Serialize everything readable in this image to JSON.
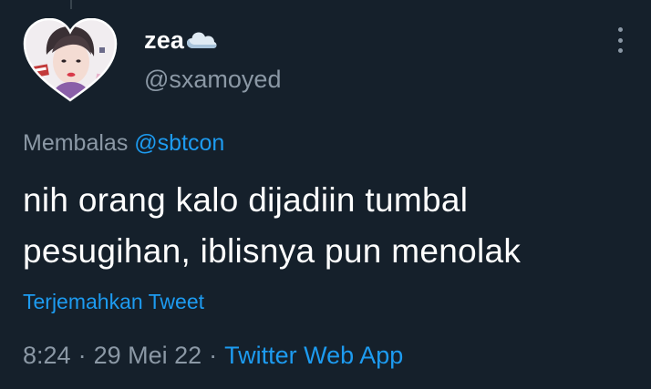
{
  "tweet": {
    "display_name": "zea",
    "name_emoji": "cloud-icon",
    "handle": "@sxamoyed",
    "reply_prefix": "Membalas",
    "reply_mention": "@sbtcon",
    "text_line1": "nih orang kalo dijadiin tumbal",
    "text_line2": "pesugihan, iblisnya pun menolak",
    "translate_label": "Terjemahkan Tweet",
    "time": "8:24",
    "date": "29 Mei 22",
    "separator": "·",
    "source": "Twitter Web App"
  },
  "theme": {
    "background": "#15202b",
    "text": "#ffffff",
    "muted": "#8b98a5",
    "accent": "#1d9bf0"
  }
}
